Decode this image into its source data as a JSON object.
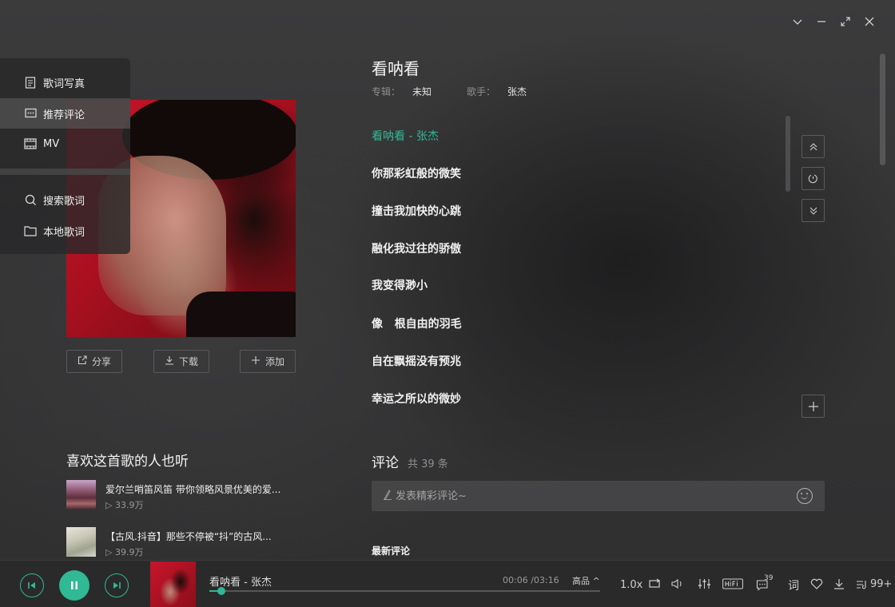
{
  "window": {
    "controls": [
      "collapse",
      "minimize",
      "fullscreen",
      "close"
    ]
  },
  "sidebar": {
    "items": [
      {
        "label": "歌词写真",
        "icon": "document-icon",
        "active": false
      },
      {
        "label": "推荐评论",
        "icon": "comment-icon",
        "active": true
      },
      {
        "label": "MV",
        "icon": "film-icon",
        "active": false
      }
    ],
    "tools": [
      {
        "label": "搜索歌词",
        "icon": "search-icon"
      },
      {
        "label": "本地歌词",
        "icon": "folder-icon"
      }
    ]
  },
  "actions": {
    "share": "分享",
    "download": "下载",
    "add": "添加"
  },
  "song": {
    "title": "看呐看",
    "album_label": "专辑：",
    "album": "未知",
    "artist_label": "歌手：",
    "artist": "张杰"
  },
  "lyrics": [
    "看呐看 - 张杰",
    "你那彩虹般的微笑",
    "撞击我加快的心跳",
    "融化我过往的骄傲",
    "我变得渺小",
    "像   根自由的羽毛",
    "自在飘摇没有预兆",
    "幸运之所以的微妙"
  ],
  "recommend": {
    "title": "喜欢这首歌的人也听",
    "items": [
      {
        "name": "爱尔兰哨笛风笛 带你领略风景优美的爱...",
        "plays": "33.9万"
      },
      {
        "name": "【古风.抖音】那些不停被“抖”的古风...",
        "plays": "39.9万"
      }
    ]
  },
  "comments": {
    "title": "评论",
    "count": "共 39 条",
    "placeholder": "发表精彩评论~",
    "newest_label": "最新评论"
  },
  "player": {
    "song": "看呐看 - 张杰",
    "time": "00:06 /03:16",
    "quality": "高品 ^",
    "progress": 0.031,
    "speed": "1.0x",
    "comment_badge": "39",
    "lyric_button": "词",
    "playlist_count": "99+"
  },
  "colors": {
    "accent": "#2fb995",
    "background": "#363637",
    "player_bg": "#2a2a2b"
  }
}
